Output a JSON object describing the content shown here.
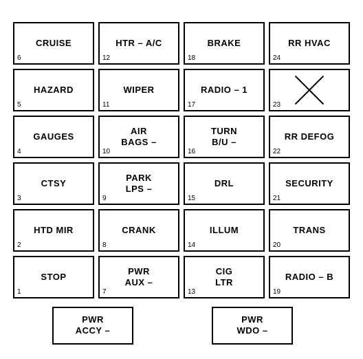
{
  "fuses": [
    {
      "id": 1,
      "label": "STOP",
      "number": "1",
      "row": 6,
      "col": 1
    },
    {
      "id": 2,
      "label": "HTD MIR",
      "number": "2",
      "row": 5,
      "col": 1
    },
    {
      "id": 3,
      "label": "CTSY",
      "number": "3",
      "row": 4,
      "col": 1
    },
    {
      "id": 4,
      "label": "GAUGES",
      "number": "4",
      "row": 3,
      "col": 1
    },
    {
      "id": 5,
      "label": "HAZARD",
      "number": "5",
      "row": 2,
      "col": 1
    },
    {
      "id": 6,
      "label": "CRUISE",
      "number": "6",
      "row": 1,
      "col": 1
    },
    {
      "id": 7,
      "label": "PWR\nAUX",
      "number": "7",
      "row": 6,
      "col": 2
    },
    {
      "id": 8,
      "label": "CRANK",
      "number": "8",
      "row": 5,
      "col": 2
    },
    {
      "id": 9,
      "label": "PARK\nLPS",
      "number": "9",
      "row": 4,
      "col": 2
    },
    {
      "id": 10,
      "label": "AIR\nBAGS",
      "number": "10",
      "row": 3,
      "col": 2
    },
    {
      "id": 11,
      "label": "WIPER",
      "number": "11",
      "row": 2,
      "col": 2
    },
    {
      "id": 12,
      "label": "HTR – A/C",
      "number": "12",
      "row": 1,
      "col": 2
    },
    {
      "id": 13,
      "label": "CIG\nLTR",
      "number": "13",
      "row": 6,
      "col": 3
    },
    {
      "id": 14,
      "label": "ILLUM",
      "number": "14",
      "row": 5,
      "col": 3
    },
    {
      "id": 15,
      "label": "DRL",
      "number": "15",
      "row": 4,
      "col": 3
    },
    {
      "id": 16,
      "label": "TURN\nB/U",
      "number": "16",
      "row": 3,
      "col": 3
    },
    {
      "id": 17,
      "label": "RADIO – 1",
      "number": "17",
      "row": 2,
      "col": 3
    },
    {
      "id": 18,
      "label": "BRAKE",
      "number": "18",
      "row": 1,
      "col": 3
    },
    {
      "id": 19,
      "label": "RADIO – B",
      "number": "19",
      "row": 6,
      "col": 4
    },
    {
      "id": 20,
      "label": "TRANS",
      "number": "20",
      "row": 5,
      "col": 4
    },
    {
      "id": 21,
      "label": "SECURITY",
      "number": "21",
      "row": 4,
      "col": 4
    },
    {
      "id": 22,
      "label": "RR DEFOG",
      "number": "22",
      "row": 3,
      "col": 4
    },
    {
      "id": 23,
      "label": "",
      "number": "23",
      "row": 2,
      "col": 4,
      "isX": true
    },
    {
      "id": 24,
      "label": "RR HVAC",
      "number": "24",
      "row": 1,
      "col": 4
    }
  ],
  "bottom_fuses": [
    {
      "id": "bottom1",
      "label": "PWR\nACCY",
      "dash": true
    },
    {
      "id": "bottom2",
      "label": "PWR\nWDO",
      "dash": true
    }
  ]
}
